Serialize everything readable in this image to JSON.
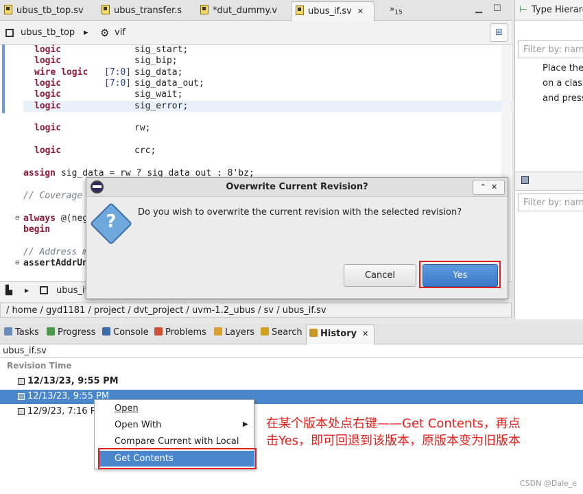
{
  "editor_tabs": [
    {
      "label": "ubus_tb_top.sv"
    },
    {
      "label": "ubus_transfer.s"
    },
    {
      "label": "*dut_dummy.v"
    },
    {
      "label": "ubus_if.sv",
      "active": true
    }
  ],
  "tab_overflow": {
    "symbol": "»",
    "count": "15"
  },
  "breadcrumb": {
    "module": "ubus_tb_top",
    "instance": "vif"
  },
  "code_lines": [
    {
      "kw": "logic",
      "range": "",
      "name": "sig_start;"
    },
    {
      "kw": "logic",
      "range": "",
      "name": "sig_bip;"
    },
    {
      "kw": "wire logic",
      "range": "[7:0]",
      "name": "sig_data;"
    },
    {
      "kw": "logic",
      "range": "[7:0]",
      "name": "sig_data_out;"
    },
    {
      "kw": "logic",
      "range": "",
      "name": "sig_wait;"
    },
    {
      "kw": "logic",
      "range": "",
      "name": "sig_error;"
    },
    {
      "kw": "logic",
      "range": "",
      "name": "rw;"
    },
    {
      "kw": "logic",
      "range": "",
      "name": "crc;"
    }
  ],
  "code_assign": {
    "kw": "assign",
    "rest": "sig_data = rw ? sig_data_out : 8'bz;"
  },
  "code_comment_coverage": "// Coverage",
  "code_always": {
    "kw": "always",
    "rest": "@(neg"
  },
  "code_begin": "begin",
  "code_comment_address": "// Address m",
  "code_assert": "assertAddrUn",
  "editor_strip_label": "ubus_if",
  "file_path": "/ home / gyd1181 / project / dvt_project / uvm-1.2_ubus / sv / ubus_if.sv",
  "right_pane": {
    "title": "Type Hierarc",
    "filter_placeholder": "Filter by: name",
    "help_lines": [
      "Place the",
      "on a class",
      "and press"
    ],
    "filter2_placeholder": "Filter by: name"
  },
  "panel_tabs": [
    {
      "label": "Tasks",
      "color": "#6a8cb8"
    },
    {
      "label": "Progress",
      "color": "#4a9a4a"
    },
    {
      "label": "Console",
      "color": "#3c6aa8"
    },
    {
      "label": "Problems",
      "color": "#d0503a"
    },
    {
      "label": "Layers",
      "color": "#d8a030"
    },
    {
      "label": "Search",
      "color": "#d0a020"
    },
    {
      "label": "History",
      "color": "#c89828",
      "active": true
    }
  ],
  "history": {
    "file": "ubus_if.sv",
    "column": "Revision Time",
    "rows": [
      {
        "time": "12/13/23, 9:55 PM",
        "bold": true
      },
      {
        "time": "12/13/23, 9:55 PM",
        "selected": true
      },
      {
        "time": "12/9/23, 7:16 PM"
      }
    ]
  },
  "context_menu": [
    "Open",
    "Open With",
    "Compare Current with Local",
    "Get Contents"
  ],
  "dialog": {
    "title": "Overwrite Current Revision?",
    "message": "Do you wish to overwrite the current revision with the selected revision?",
    "cancel": "Cancel",
    "yes": "Yes",
    "question_mark": "?"
  },
  "annotation": [
    "在某个版本处点右键——Get Contents，再点",
    "击Yes，即可回退到该版本，原版本变为旧版本"
  ],
  "watermark": "CSDN @Dale_e",
  "colors": {
    "annotation_red": "#e8201c",
    "selection_blue": "#4a86cc",
    "keyword": "#8f1a3a"
  }
}
